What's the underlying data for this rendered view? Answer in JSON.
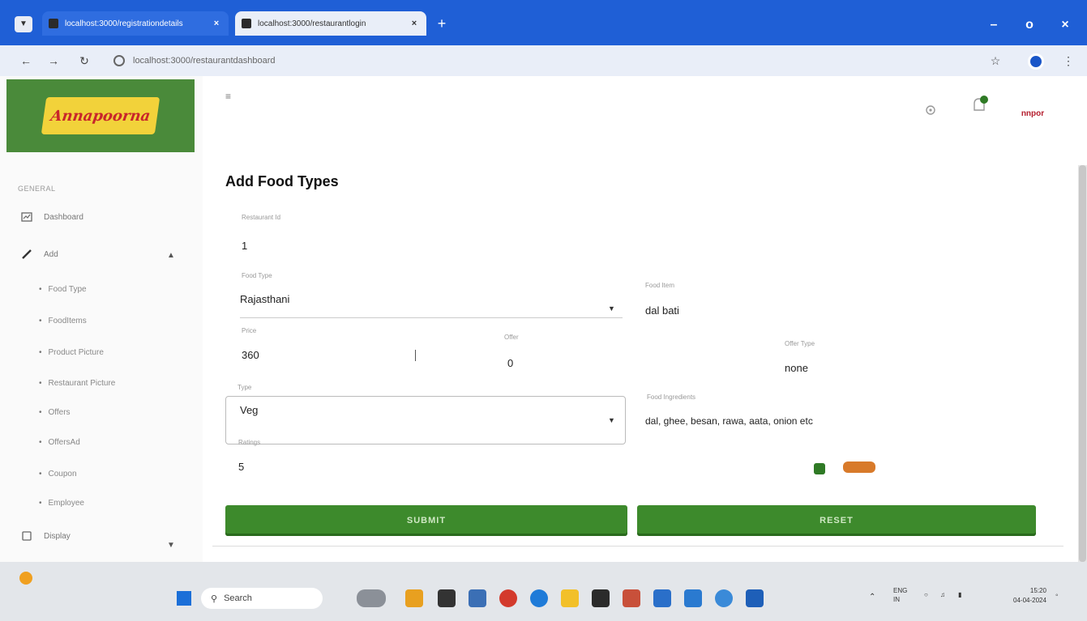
{
  "browser": {
    "tabs": [
      {
        "label": "localhost:3000/registrationdetails",
        "active": false
      },
      {
        "label": "localhost:3000/restaurantlogin",
        "active": true
      }
    ],
    "url": "localhost:3000/restaurantdashboard",
    "new_tab": "+",
    "window_controls": {
      "minimize": "–",
      "maximize": "o",
      "close": "×"
    }
  },
  "sidebar": {
    "logo_text": "Annapoorna",
    "section_title": "GENERAL",
    "items": [
      {
        "label": "Dashboard",
        "icon": "dashboard-icon"
      },
      {
        "label": "Add",
        "icon": "pencil-icon"
      },
      {
        "label": "Display",
        "icon": "display-icon"
      }
    ],
    "sub_items": [
      "Food Type",
      "FoodItems",
      "Product Picture",
      "Restaurant Picture",
      "Offers",
      "OffersAd",
      "Coupon",
      "Employee"
    ]
  },
  "header": {
    "avatar_text": "nnpor"
  },
  "form": {
    "title": "Add Food Types",
    "restaurant_id": {
      "label": "Restaurant Id",
      "value": "1"
    },
    "food_type": {
      "label": "Food Type",
      "value": "Rajasthani"
    },
    "food_item": {
      "label": "Food Item",
      "value": "dal bati"
    },
    "price": {
      "label": "Price",
      "value": "360"
    },
    "offer": {
      "label": "Offer",
      "value": "0"
    },
    "offer_type": {
      "label": "Offer Type",
      "value": "none"
    },
    "type": {
      "label": "Type",
      "value": "Veg"
    },
    "food_ingredients": {
      "label": "Food Ingredients",
      "value": "dal, ghee, besan, rawa, aata, onion etc"
    },
    "ratings": {
      "label": "Ratings",
      "value": "5"
    },
    "submit_label": "SUBMIT",
    "reset_label": "RESET"
  },
  "taskbar": {
    "search_placeholder": "Search",
    "lang": "ENG",
    "lang_region": "IN",
    "time": "15:20",
    "date": "04-04-2024"
  },
  "colors": {
    "accent_green": "#3d8a2c",
    "browser_blue": "#1f5fd6"
  }
}
